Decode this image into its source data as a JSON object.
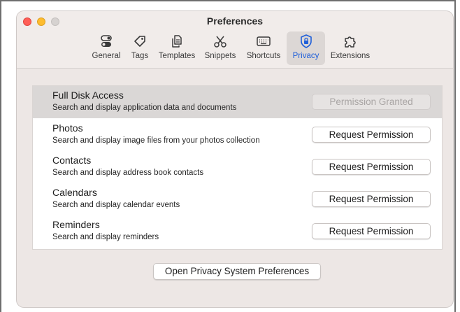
{
  "window": {
    "title": "Preferences"
  },
  "toolbar": {
    "items": [
      {
        "label": "General",
        "icon": "toggle-icon"
      },
      {
        "label": "Tags",
        "icon": "tag-icon"
      },
      {
        "label": "Templates",
        "icon": "templates-icon"
      },
      {
        "label": "Snippets",
        "icon": "snippets-icon"
      },
      {
        "label": "Shortcuts",
        "icon": "keyboard-icon"
      },
      {
        "label": "Privacy",
        "icon": "lock-shield-icon",
        "selected": true
      },
      {
        "label": "Extensions",
        "icon": "puzzle-icon"
      }
    ],
    "accent_color": "#1f5fd9"
  },
  "privacy": {
    "rows": [
      {
        "title": "Full Disk Access",
        "description": "Search and display application data and documents",
        "button": "Permission Granted",
        "button_enabled": false
      },
      {
        "title": "Photos",
        "description": "Search and display image files from your photos collection",
        "button": "Request Permission",
        "button_enabled": true
      },
      {
        "title": "Contacts",
        "description": "Search and display address book contacts",
        "button": "Request Permission",
        "button_enabled": true
      },
      {
        "title": "Calendars",
        "description": "Search and display calendar events",
        "button": "Request Permission",
        "button_enabled": true
      },
      {
        "title": "Reminders",
        "description": "Search and display reminders",
        "button": "Request Permission",
        "button_enabled": true
      }
    ],
    "open_button": "Open Privacy System Preferences"
  }
}
